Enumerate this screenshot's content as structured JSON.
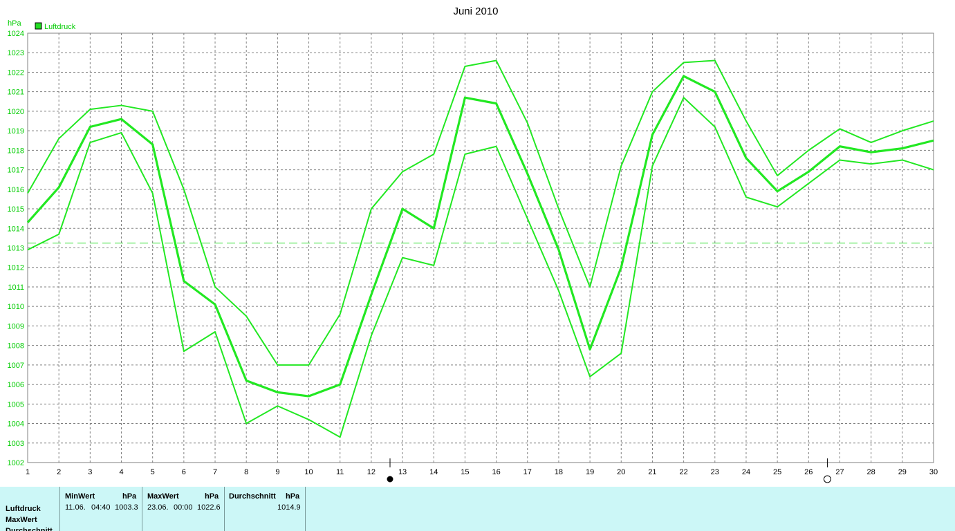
{
  "chart_data": {
    "type": "line",
    "title": "Juni 2010",
    "y_unit": "hPa",
    "ylim": [
      1002,
      1024
    ],
    "y_ticks": [
      1002,
      1003,
      1004,
      1005,
      1006,
      1007,
      1008,
      1009,
      1010,
      1011,
      1012,
      1013,
      1014,
      1015,
      1016,
      1017,
      1018,
      1019,
      1020,
      1021,
      1022,
      1023,
      1024
    ],
    "x": [
      1,
      2,
      3,
      4,
      5,
      6,
      7,
      8,
      9,
      10,
      11,
      12,
      13,
      14,
      15,
      16,
      17,
      18,
      19,
      20,
      21,
      22,
      23,
      24,
      25,
      26,
      27,
      28,
      29,
      30
    ],
    "legend": [
      "Luftdruck"
    ],
    "reference_line": 1013.25,
    "grid": true,
    "series": [
      {
        "values": [
          1015.8,
          1018.6,
          1020.1,
          1020.3,
          1020.0,
          1016.0,
          1011.0,
          1009.5,
          1007.0,
          1007.0,
          1009.6,
          1015.0,
          1016.9,
          1017.8,
          1022.3,
          1022.6,
          1019.4,
          1015.0,
          1011.0,
          1017.2,
          1021.0,
          1022.5,
          1022.6,
          1019.5,
          1016.7,
          1018.0,
          1019.1,
          1018.4,
          1019.0,
          1019.5
        ]
      },
      {
        "values": [
          1014.3,
          1016.1,
          1019.2,
          1019.6,
          1018.3,
          1011.3,
          1010.1,
          1006.2,
          1005.6,
          1005.4,
          1006.0,
          1010.6,
          1015.0,
          1014.0,
          1020.7,
          1020.4,
          1016.8,
          1012.9,
          1007.8,
          1012.0,
          1018.8,
          1021.8,
          1021.0,
          1017.6,
          1015.9,
          1016.9,
          1018.2,
          1017.9,
          1018.1,
          1018.5
        ]
      },
      {
        "values": [
          1012.9,
          1013.7,
          1018.4,
          1018.9,
          1015.8,
          1007.7,
          1008.7,
          1004.0,
          1004.9,
          1004.2,
          1003.3,
          1008.5,
          1012.5,
          1012.1,
          1017.8,
          1018.2,
          1014.5,
          1010.8,
          1006.4,
          1007.6,
          1017.2,
          1020.7,
          1019.2,
          1015.6,
          1015.1,
          1016.3,
          1017.5,
          1017.3,
          1017.5,
          1017.0
        ]
      }
    ],
    "colors": {
      "line": "#22e822",
      "grid": "#808080",
      "axis": "#808080"
    },
    "markers": [
      {
        "x": 12.6,
        "icon": "new-moon-icon",
        "glyph": "●"
      },
      {
        "x": 26.6,
        "icon": "full-moon-icon",
        "glyph": "○"
      }
    ]
  },
  "stats": {
    "row_labels": [
      "Luftdruck",
      "MaxWert",
      "Durchschnitt"
    ],
    "min": {
      "header": "MinWert",
      "unit": "hPa",
      "date": "11.06.",
      "time": "04:40",
      "value": "1003.3"
    },
    "max": {
      "header": "MaxWert",
      "unit": "hPa",
      "date": "23.06.",
      "time": "00:00",
      "value": "1022.6"
    },
    "avg": {
      "header": "Durchschnitt",
      "unit": "hPa",
      "value": "1014.9"
    }
  }
}
